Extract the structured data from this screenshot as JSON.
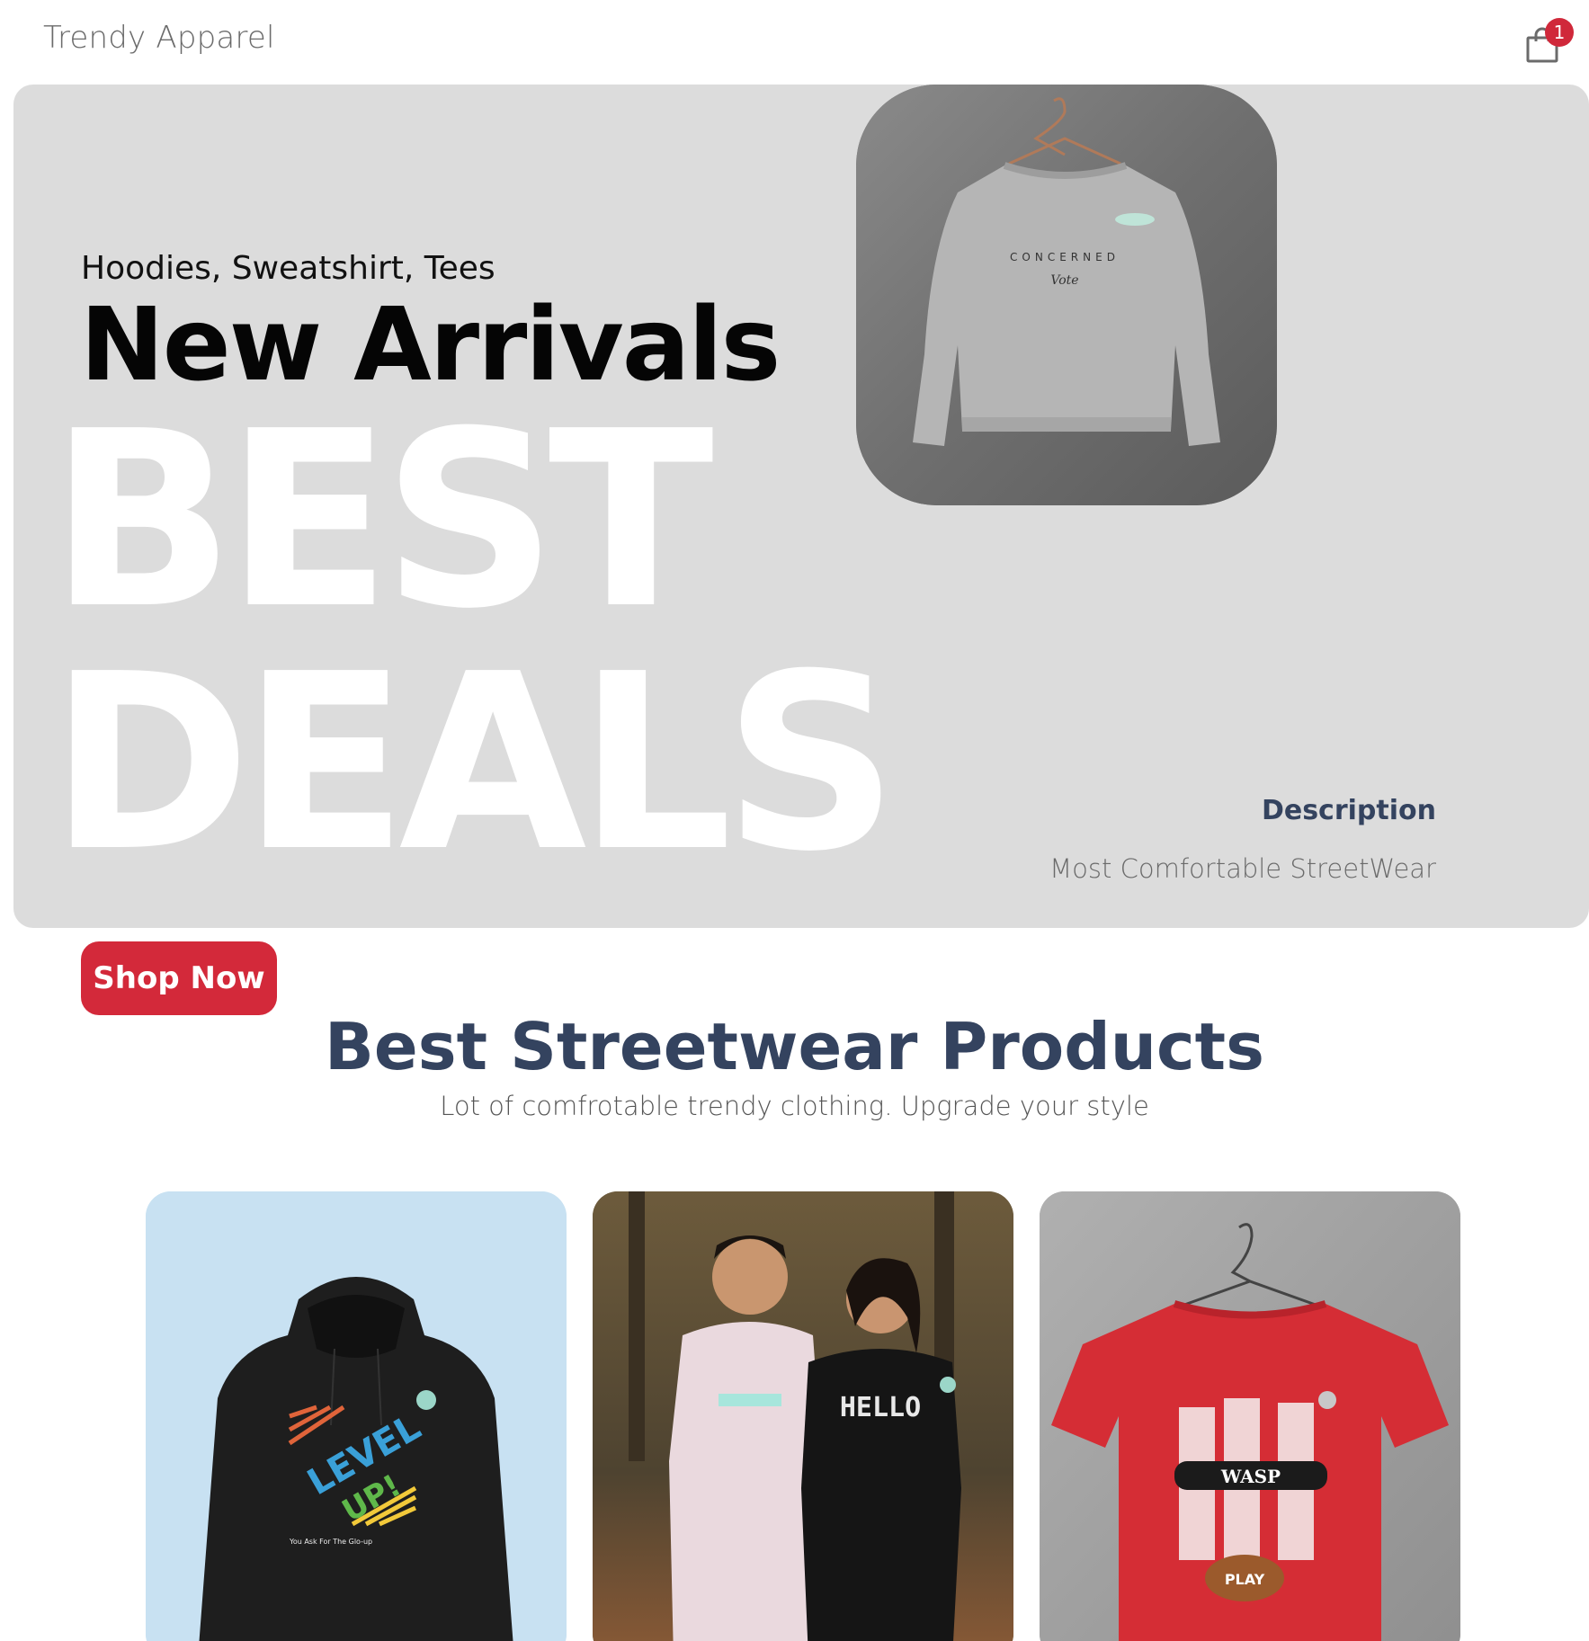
{
  "header": {
    "brand": "Trendy Apparel",
    "cart_count": "1"
  },
  "hero": {
    "categories": "Hoodies, Sweatshirt, Tees",
    "title": "New Arrivals",
    "background_line1": "BEST",
    "background_line2": "DEALS",
    "image_text_top": "CONCERNED",
    "image_text_script": "Vote",
    "description_title": "Description",
    "description_text": "Most Comfortable StreetWear"
  },
  "cta": {
    "shop_now": "Shop Now"
  },
  "section": {
    "title": "Best Streetwear Products",
    "subtitle": "Lot of comfrotable trendy clothing. Upgrade your style"
  },
  "products": [
    {
      "print_line1": "LEVEL",
      "print_line2": "UP!",
      "print_caption": "You Ask For The Glo-up"
    },
    {
      "print_text": "HELLO"
    },
    {
      "print_text": "WASP",
      "print_badge": "PLAY"
    }
  ],
  "colors": {
    "accent": "#d3293a",
    "heading": "#34435f",
    "hero_bg": "#dcdcdc"
  }
}
